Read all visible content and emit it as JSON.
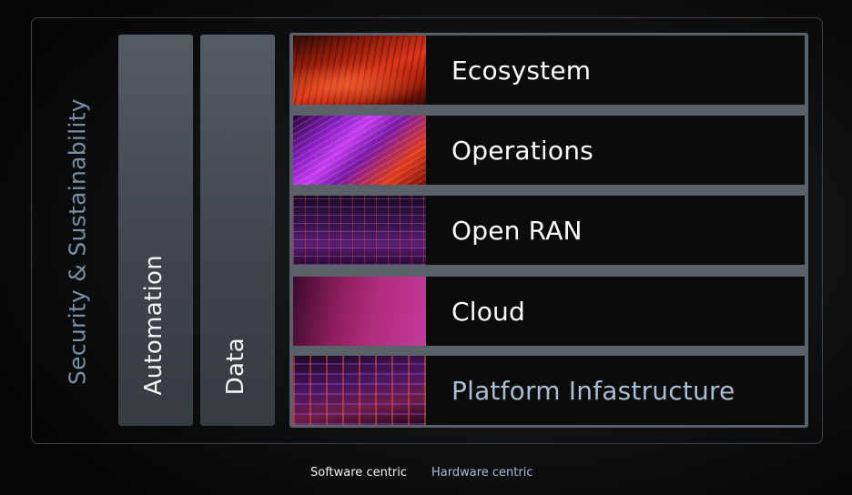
{
  "outer_label": "Security & Sustainability",
  "pillars": [
    {
      "label": "Automation"
    },
    {
      "label": "Data"
    }
  ],
  "layers": [
    {
      "label": "Ecosystem",
      "image": "red-planet-surface-image"
    },
    {
      "label": "Operations",
      "image": "purple-light-streaks-image"
    },
    {
      "label": "Open RAN",
      "image": "network-grid-image"
    },
    {
      "label": "Cloud",
      "image": "magenta-gradient-image"
    },
    {
      "label": "Platform Infastructure",
      "image": "hardware-circuit-image"
    }
  ],
  "legend": {
    "software": "Software centric",
    "hardware": "Hardware centric"
  },
  "colors": {
    "background": "#000000",
    "pillar": "#4a5057",
    "layer_bg": "#0b0b0c",
    "label_white": "#ffffff",
    "label_muted_blue": "#a9bdd3",
    "outer_label": "#7b8fa3"
  }
}
